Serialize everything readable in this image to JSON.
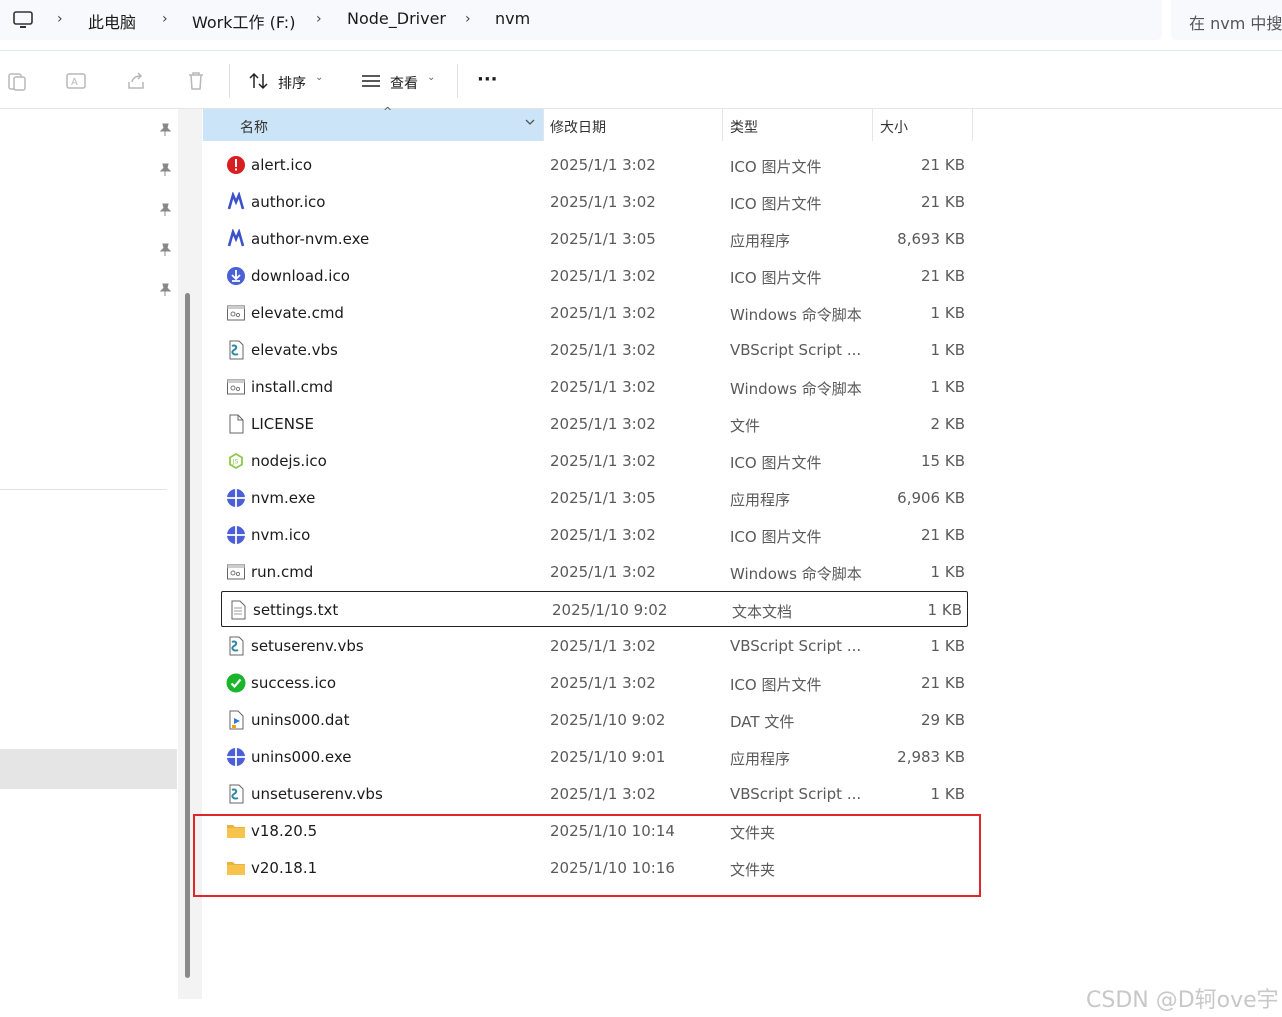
{
  "address": {
    "breadcrumbs": [
      "此电脑",
      "Work工作 (F:)",
      "Node_Driver",
      "nvm"
    ],
    "search_placeholder": "在 nvm 中搜索"
  },
  "toolbar": {
    "sort_label": "排序",
    "view_label": "查看",
    "more_label": "···"
  },
  "columns": {
    "name": "名称",
    "modified": "修改日期",
    "type": "类型",
    "size": "大小"
  },
  "files": [
    {
      "name": "alert.ico",
      "modified": "2025/1/1 3:02",
      "type": "ICO 图片文件",
      "size": "21 KB",
      "icon": "alert-icon"
    },
    {
      "name": "author.ico",
      "modified": "2025/1/1 3:02",
      "type": "ICO 图片文件",
      "size": "21 KB",
      "icon": "author-icon"
    },
    {
      "name": "author-nvm.exe",
      "modified": "2025/1/1 3:05",
      "type": "应用程序",
      "size": "8,693 KB",
      "icon": "author-icon"
    },
    {
      "name": "download.ico",
      "modified": "2025/1/1 3:02",
      "type": "ICO 图片文件",
      "size": "21 KB",
      "icon": "download-icon"
    },
    {
      "name": "elevate.cmd",
      "modified": "2025/1/1 3:02",
      "type": "Windows 命令脚本",
      "size": "1 KB",
      "icon": "cmd-file-icon"
    },
    {
      "name": "elevate.vbs",
      "modified": "2025/1/1 3:02",
      "type": "VBScript Script ...",
      "size": "1 KB",
      "icon": "vbs-file-icon"
    },
    {
      "name": "install.cmd",
      "modified": "2025/1/1 3:02",
      "type": "Windows 命令脚本",
      "size": "1 KB",
      "icon": "cmd-file-icon"
    },
    {
      "name": "LICENSE",
      "modified": "2025/1/1 3:02",
      "type": "文件",
      "size": "2 KB",
      "icon": "blank-file-icon"
    },
    {
      "name": "nodejs.ico",
      "modified": "2025/1/1 3:02",
      "type": "ICO 图片文件",
      "size": "15 KB",
      "icon": "nodejs-icon"
    },
    {
      "name": "nvm.exe",
      "modified": "2025/1/1 3:05",
      "type": "应用程序",
      "size": "6,906 KB",
      "icon": "nvm-icon"
    },
    {
      "name": "nvm.ico",
      "modified": "2025/1/1 3:02",
      "type": "ICO 图片文件",
      "size": "21 KB",
      "icon": "nvm-icon"
    },
    {
      "name": "run.cmd",
      "modified": "2025/1/1 3:02",
      "type": "Windows 命令脚本",
      "size": "1 KB",
      "icon": "cmd-file-icon"
    },
    {
      "name": "settings.txt",
      "modified": "2025/1/10 9:02",
      "type": "文本文档",
      "size": "1 KB",
      "icon": "text-file-icon"
    },
    {
      "name": "setuserenv.vbs",
      "modified": "2025/1/1 3:02",
      "type": "VBScript Script ...",
      "size": "1 KB",
      "icon": "vbs-file-icon"
    },
    {
      "name": "success.ico",
      "modified": "2025/1/1 3:02",
      "type": "ICO 图片文件",
      "size": "21 KB",
      "icon": "success-icon"
    },
    {
      "name": "unins000.dat",
      "modified": "2025/1/10 9:02",
      "type": "DAT 文件",
      "size": "29 KB",
      "icon": "dat-file-icon"
    },
    {
      "name": "unins000.exe",
      "modified": "2025/1/10 9:01",
      "type": "应用程序",
      "size": "2,983 KB",
      "icon": "nvm-icon"
    },
    {
      "name": "unsetuserenv.vbs",
      "modified": "2025/1/1 3:02",
      "type": "VBScript Script ...",
      "size": "1 KB",
      "icon": "vbs-file-icon"
    },
    {
      "name": "v18.20.5",
      "modified": "2025/1/10 10:14",
      "type": "文件夹",
      "size": "",
      "icon": "folder-icon"
    },
    {
      "name": "v20.18.1",
      "modified": "2025/1/10 10:16",
      "type": "文件夹",
      "size": "",
      "icon": "folder-icon"
    }
  ],
  "focused_file": "settings.txt",
  "highlighted_files": [
    "v18.20.5",
    "v20.18.1"
  ],
  "colors": {
    "header_selected": "#cce4f7",
    "highlight_box": "#e0252b",
    "nvm_blue": "#4a5fd8",
    "folder_yellow": "#f6c44c"
  },
  "watermark": "CSDN @D轲ove宇"
}
